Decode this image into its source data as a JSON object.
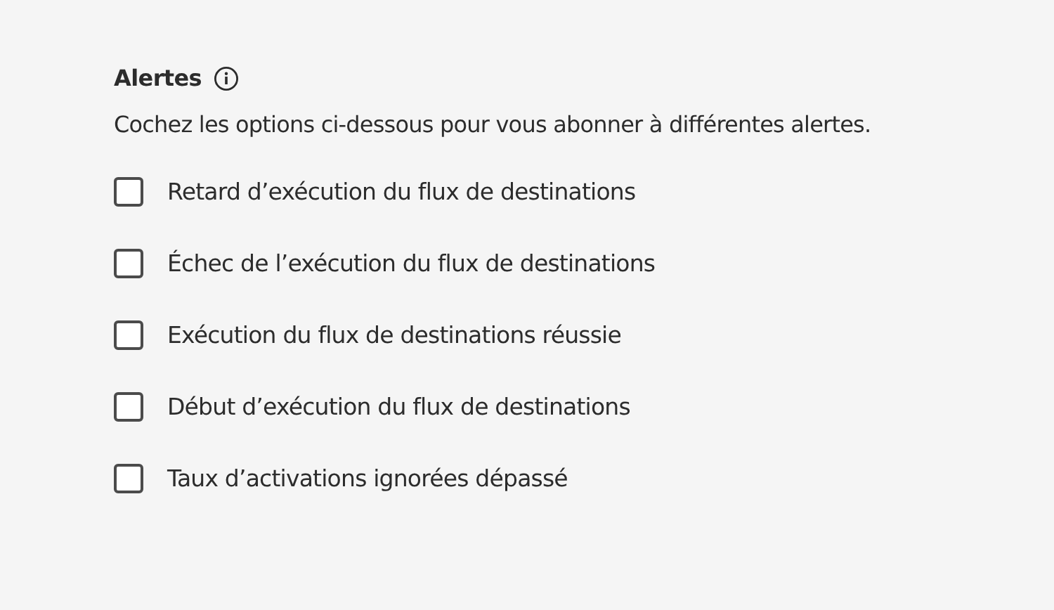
{
  "section": {
    "title": "Alertes",
    "description": "Cochez les options ci-dessous pour vous abonner à différentes alertes."
  },
  "alerts": [
    {
      "label": "Retard d’exécution du flux de destinations",
      "checked": false
    },
    {
      "label": "Échec de l’exécution du flux de destinations",
      "checked": false
    },
    {
      "label": "Exécution du flux de destinations réussie",
      "checked": false
    },
    {
      "label": "Début d’exécution du flux de destinations",
      "checked": false
    },
    {
      "label": "Taux d’activations ignorées dépassé",
      "checked": false
    }
  ]
}
